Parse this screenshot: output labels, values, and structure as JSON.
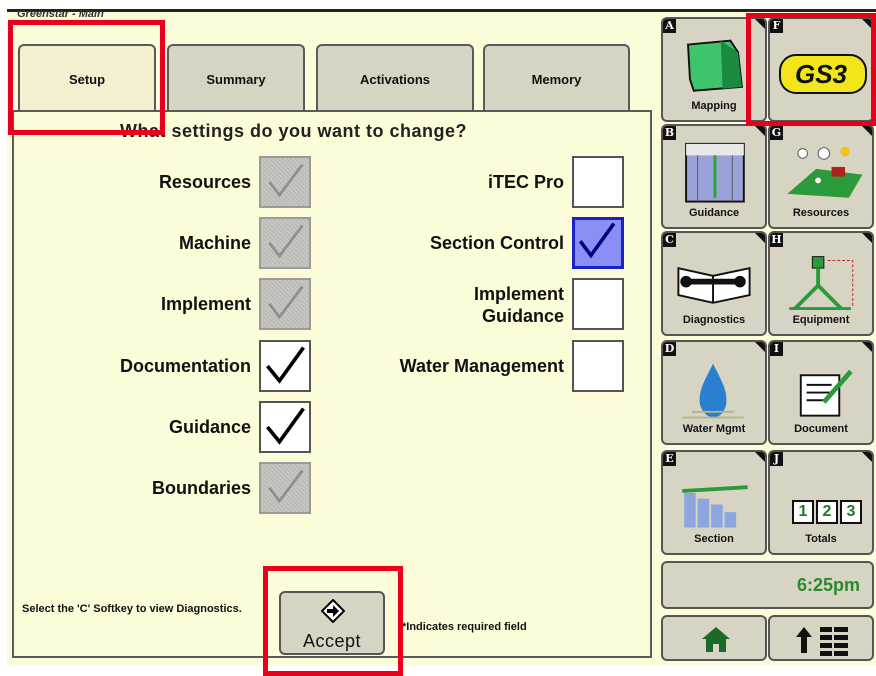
{
  "window": {
    "title": "Greenstar - Main"
  },
  "tabs": [
    {
      "label": "Setup",
      "active": true
    },
    {
      "label": "Summary",
      "active": false
    },
    {
      "label": "Activations",
      "active": false
    },
    {
      "label": "Memory",
      "active": false
    }
  ],
  "main": {
    "question": "What settings do you want to change?",
    "left_items": [
      {
        "label": "Resources",
        "state": "disabled"
      },
      {
        "label": "Machine",
        "state": "disabled"
      },
      {
        "label": "Implement",
        "state": "disabled"
      },
      {
        "label": "Documentation",
        "state": "checked"
      },
      {
        "label": "Guidance",
        "state": "checked"
      },
      {
        "label": "Boundaries",
        "state": "disabled"
      }
    ],
    "right_items": [
      {
        "label": "iTEC Pro",
        "state": "unchecked"
      },
      {
        "label": "Section Control",
        "state": "selected"
      },
      {
        "label_line1": "Implement",
        "label_line2": "Guidance",
        "state": "unchecked"
      },
      {
        "label": "Water Management",
        "state": "unchecked"
      }
    ],
    "hint": "Select the 'C' Softkey to view Diagnostics.",
    "required_note": "*Indicates required field",
    "accept_label": "Accept"
  },
  "softkeys": [
    {
      "key": "A",
      "label": "Mapping",
      "icon": "mapping-icon"
    },
    {
      "key": "F",
      "label": "GS3",
      "icon": "gs3-logo"
    },
    {
      "key": "B",
      "label": "Guidance",
      "icon": "guidance-icon"
    },
    {
      "key": "G",
      "label": "Resources",
      "icon": "resources-icon"
    },
    {
      "key": "C",
      "label": "Diagnostics",
      "icon": "diagnostics-icon"
    },
    {
      "key": "H",
      "label": "Equipment",
      "icon": "equipment-icon"
    },
    {
      "key": "D",
      "label": "Water Mgmt",
      "icon": "water-drop-icon"
    },
    {
      "key": "I",
      "label": "Document",
      "icon": "document-icon"
    },
    {
      "key": "E",
      "label": "Section",
      "icon": "section-icon"
    },
    {
      "key": "J",
      "label": "Totals",
      "icon": "totals-icon",
      "digits": [
        "1",
        "2",
        "3"
      ]
    }
  ],
  "status": {
    "clock": "6:25pm"
  },
  "nav": {
    "home_icon": "home-icon",
    "menu_icon": "menu-up-icon"
  },
  "colors": {
    "background": "#fdfcd9",
    "button": "#d8d4c3",
    "selected": "#8a8ef5",
    "highlight": "#e8001c",
    "clock": "#2a8a2a"
  }
}
